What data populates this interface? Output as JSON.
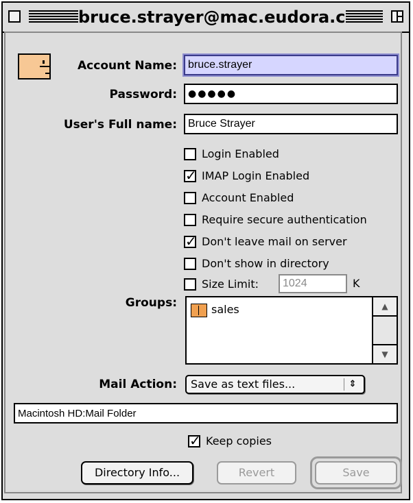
{
  "window": {
    "title": "bruce.strayer@mac.eudora.com"
  },
  "form": {
    "account_name_label": "Account Name:",
    "account_name_value": "bruce.strayer",
    "password_label": "Password:",
    "password_value": "●●●●●",
    "full_name_label": "User's Full name:",
    "full_name_value": "Bruce Strayer"
  },
  "options": [
    {
      "label": "Login Enabled",
      "checked": false
    },
    {
      "label": "IMAP Login Enabled",
      "checked": true
    },
    {
      "label": "Account Enabled",
      "checked": false
    },
    {
      "label": "Require secure authentication",
      "checked": false
    },
    {
      "label": "Don't leave mail on server",
      "checked": true
    },
    {
      "label": "Don't show in directory",
      "checked": false
    }
  ],
  "size_limit": {
    "label": "Size Limit:",
    "value": "1024",
    "unit": "K",
    "checked": false
  },
  "groups": {
    "label": "Groups:",
    "items": [
      "sales"
    ]
  },
  "mail_action": {
    "label": "Mail Action:",
    "selected": "Save as text files...",
    "arrows": "⇕"
  },
  "folder_path": "Macintosh HD:Mail Folder",
  "keep_copies": {
    "label": "Keep copies",
    "checked": true
  },
  "buttons": {
    "directory_info": "Directory Info...",
    "revert": "Revert",
    "save": "Save"
  },
  "icons": {
    "account_icon": "face-icon",
    "group_icon": "group-icon"
  }
}
